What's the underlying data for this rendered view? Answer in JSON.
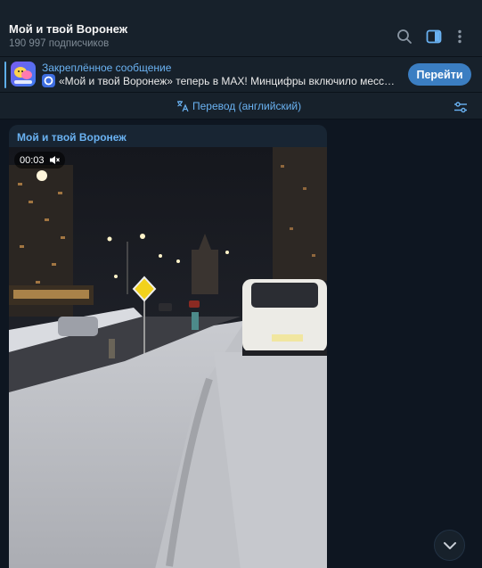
{
  "channel": {
    "title": "Мой и твой Воронеж",
    "subscribers": "190 997 подписчиков"
  },
  "header_icons": [
    "search-icon",
    "sidebar-toggle-icon",
    "more-vertical-icon"
  ],
  "pinned": {
    "label": "Закреплённое сообщение",
    "text": "«Мой и твой Воронеж» теперь в MAX!  Минцифры включило мессендже…",
    "button": "Перейти"
  },
  "translate": {
    "label": "Перевод (английский)"
  },
  "message": {
    "author": "Мой и твой Воронеж",
    "video_duration": "00:03",
    "muted": true
  },
  "colors": {
    "background": "#0e1621",
    "panel": "#17212b",
    "bubble": "#182533",
    "accent": "#6ab2f2",
    "button": "#3b7ec2"
  }
}
